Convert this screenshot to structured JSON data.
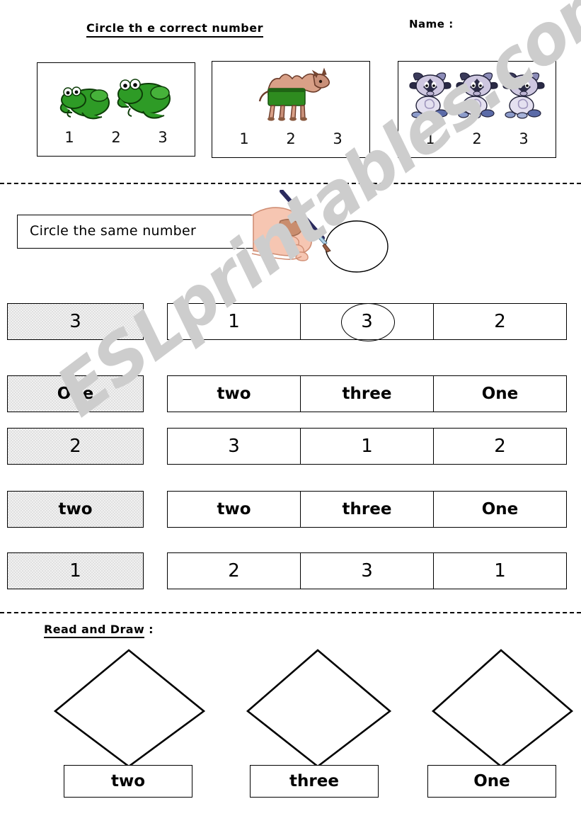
{
  "header": {
    "title": "Circle th e correct number",
    "name_label": "Name :"
  },
  "count_section": {
    "boxes": [
      {
        "animal": "frog",
        "animal_count": 2,
        "options": [
          "1",
          "2",
          "3"
        ]
      },
      {
        "animal": "camel",
        "animal_count": 1,
        "options": [
          "1",
          "2",
          "3"
        ]
      },
      {
        "animal": "cow",
        "animal_count": 3,
        "options": [
          "1",
          "2",
          "3"
        ]
      }
    ]
  },
  "match_section": {
    "instruction": "Circle  the same number",
    "hand_icon": "hand-with-pencil-icon",
    "rows": [
      {
        "cue": "3",
        "kind": "number",
        "options": [
          "1",
          "3",
          "2"
        ],
        "circled_index": 1
      },
      {
        "cue": "One",
        "kind": "word",
        "options": [
          "two",
          "three",
          "One"
        ],
        "circled_index": -1
      },
      {
        "cue": "2",
        "kind": "number",
        "options": [
          "3",
          "1",
          "2"
        ],
        "circled_index": -1
      },
      {
        "cue": "two",
        "kind": "word",
        "options": [
          "two",
          "three",
          "One"
        ],
        "circled_index": -1
      },
      {
        "cue": "1",
        "kind": "number",
        "options": [
          "2",
          "3",
          "1"
        ],
        "circled_index": -1
      }
    ]
  },
  "draw_section": {
    "title": "Read and Draw",
    "title_suffix": " :",
    "items": [
      {
        "shape": "diamond",
        "label": "two"
      },
      {
        "shape": "diamond",
        "label": "three"
      },
      {
        "shape": "diamond",
        "label": "One"
      }
    ]
  },
  "watermark": {
    "text": "ESLprintables.com",
    "color": "#cdcdcd"
  },
  "colors": {
    "ink": "#000000",
    "cue_fill": "#e0e0e0",
    "frog_green": "#2E9B26",
    "frog_dark": "#166610",
    "camel_body": "#D9A087",
    "camel_shorts": "#2E8B1F",
    "cow_body": "#CEC7E0",
    "cow_dark": "#3A3A5A",
    "skin": "#F6C6B2",
    "pencil": "#2B2B5E"
  }
}
